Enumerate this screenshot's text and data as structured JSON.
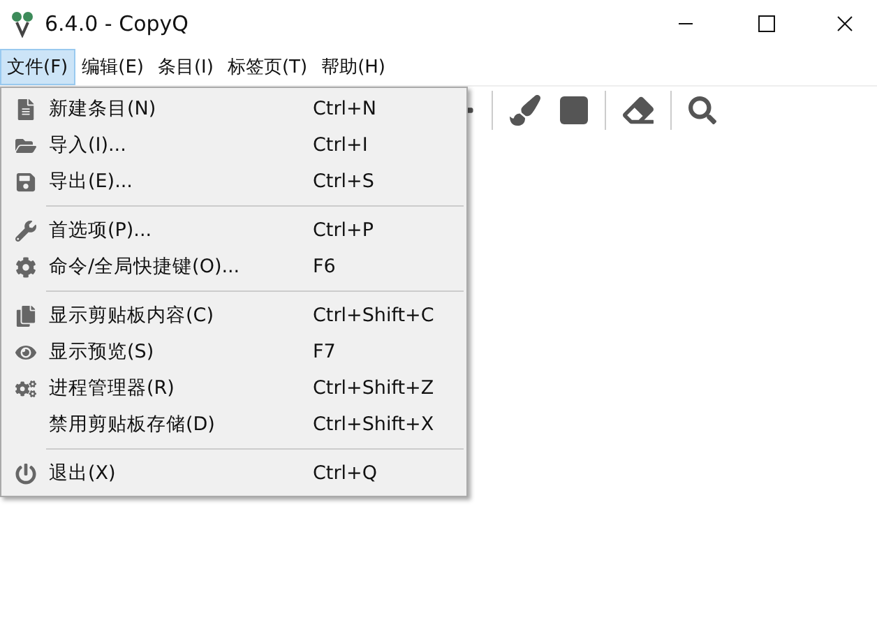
{
  "window": {
    "title": "6.4.0 - CopyQ"
  },
  "menubar": [
    {
      "label": "文件(F)",
      "selected": true
    },
    {
      "label": "编辑(E)",
      "selected": false
    },
    {
      "label": "条目(I)",
      "selected": false
    },
    {
      "label": "标签页(T)",
      "selected": false
    },
    {
      "label": "帮助(H)",
      "selected": false
    }
  ],
  "menu": {
    "groups": [
      [
        {
          "label": "新建条目(N)",
          "shortcut": "Ctrl+N"
        },
        {
          "label": "导入(I)...",
          "shortcut": "Ctrl+I"
        },
        {
          "label": "导出(E)...",
          "shortcut": "Ctrl+S"
        }
      ],
      [
        {
          "label": "首选项(P)...",
          "shortcut": "Ctrl+P"
        },
        {
          "label": "命令/全局快捷键(O)...",
          "shortcut": "F6"
        }
      ],
      [
        {
          "label": "显示剪贴板内容(C)",
          "shortcut": "Ctrl+Shift+C"
        },
        {
          "label": "显示预览(S)",
          "shortcut": "F7"
        },
        {
          "label": "进程管理器(R)",
          "shortcut": "Ctrl+Shift+Z"
        },
        {
          "label": "禁用剪贴板存储(D)",
          "shortcut": "Ctrl+Shift+X"
        }
      ],
      [
        {
          "label": "退出(X)",
          "shortcut": "Ctrl+Q"
        }
      ]
    ]
  }
}
